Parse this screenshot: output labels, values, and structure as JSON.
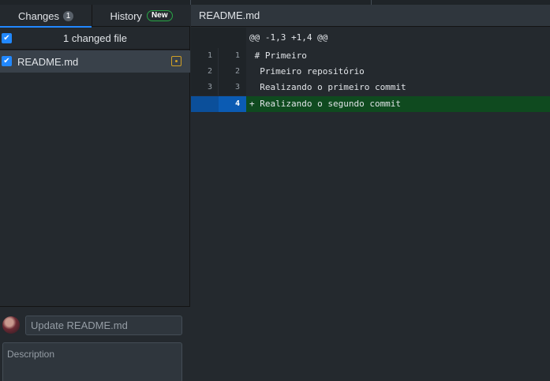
{
  "tabs": {
    "changes_label": "Changes",
    "changes_count": "1",
    "history_label": "History",
    "history_badge": "New"
  },
  "changes": {
    "select_all_label": "1 changed file",
    "files": [
      {
        "name": "README.md",
        "status": "modified",
        "checked": true
      }
    ]
  },
  "commit": {
    "summary_placeholder": "Update README.md",
    "description_placeholder": "Description"
  },
  "diff": {
    "file_name": "README.md",
    "hunk_header": "@@ -1,3 +1,4 @@",
    "lines": [
      {
        "old": "1",
        "new": "1",
        "text": " # Primeiro",
        "type": "context"
      },
      {
        "old": "2",
        "new": "2",
        "text": "  Primeiro repositório",
        "type": "context"
      },
      {
        "old": "3",
        "new": "3",
        "text": "  Realizando o primeiro commit",
        "type": "context"
      },
      {
        "old": "",
        "new": "4",
        "text": "+ Realizando o segundo commit",
        "type": "added"
      }
    ]
  },
  "colors": {
    "accent": "#2188ff",
    "added_bg": "#0f4a1f",
    "modified": "#d0a026",
    "badge_green": "#28a745"
  },
  "icons": {
    "checkbox": "checkmark-icon",
    "modified_file": "file-modified-icon",
    "avatar": "user-avatar"
  }
}
